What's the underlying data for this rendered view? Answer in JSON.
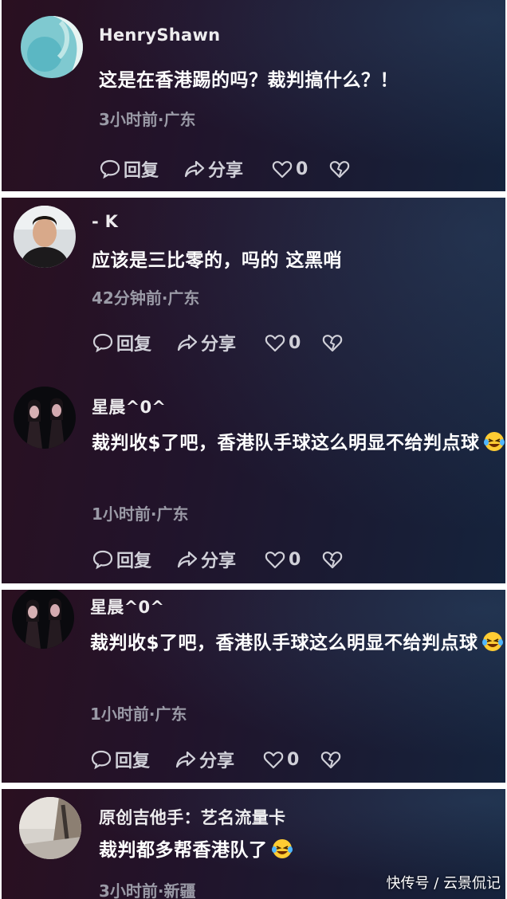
{
  "comments": [
    {
      "username": "HenryShawn",
      "text": "这是在香港踢的吗？裁判搞什么？！",
      "meta": "3小时前·广东",
      "reply_label": "回复",
      "share_label": "分享",
      "likes": "0"
    },
    {
      "username": "- K",
      "text": "应该是三比零的，吗的 这黑哨",
      "meta": "42分钟前·广东",
      "reply_label": "回复",
      "share_label": "分享",
      "likes": "0"
    },
    {
      "username": "星晨^0^",
      "text": "裁判收$了吧，香港队手球这么明显不给判点球",
      "meta": "1小时前·广东",
      "reply_label": "回复",
      "share_label": "分享",
      "likes": "0",
      "emoji": "laughing-crying-emoji"
    },
    {
      "username": "星晨^0^",
      "text": "裁判收$了吧，香港队手球这么明显不给判点球",
      "meta": "1小时前·广东",
      "reply_label": "回复",
      "share_label": "分享",
      "likes": "0",
      "emoji": "laughing-crying-emoji"
    },
    {
      "username": "原创吉他手：艺名流量卡",
      "text": "裁判都多帮香港队了",
      "meta": "3小时前·新疆",
      "emoji": "laughing-crying-emoji"
    }
  ],
  "watermark": "快传号 / 云景侃记",
  "colors": {
    "text": "#ffffff",
    "meta": "#9a9aa6",
    "panel_left": "#2a1020",
    "panel_right": "#15233c"
  }
}
